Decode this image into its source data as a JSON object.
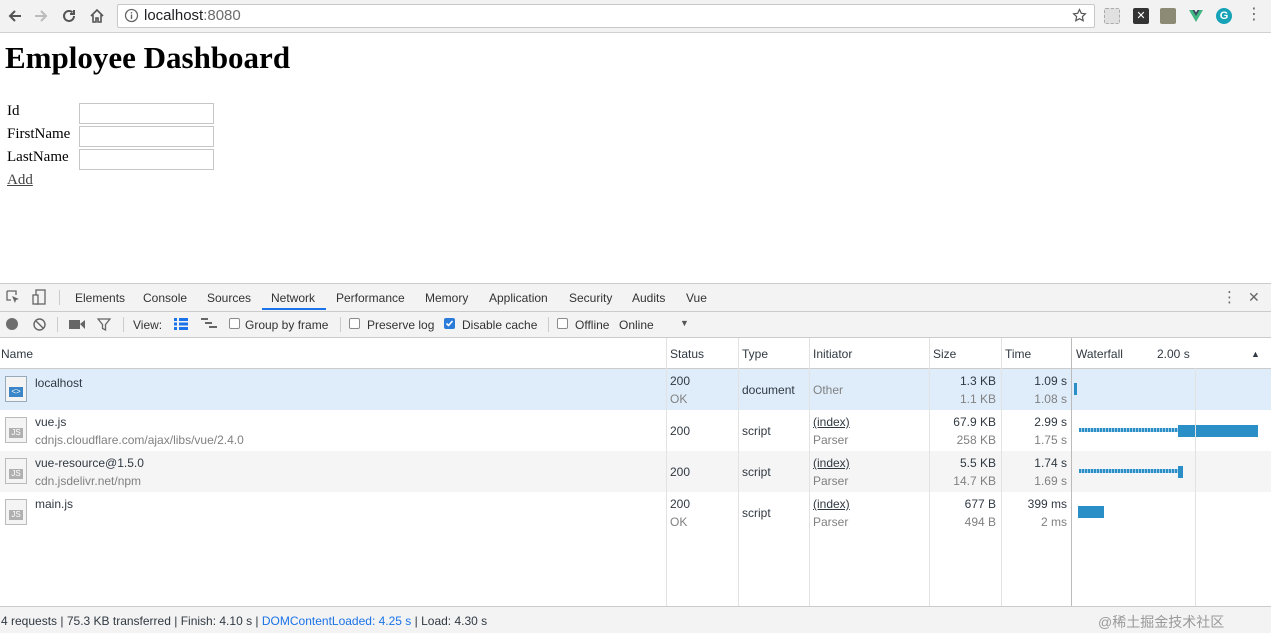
{
  "browser": {
    "url_host": "localhost",
    "url_port": ":8080"
  },
  "page": {
    "title": "Employee Dashboard",
    "fields": [
      {
        "label": "Id",
        "value": ""
      },
      {
        "label": "FirstName",
        "value": ""
      },
      {
        "label": "LastName",
        "value": ""
      }
    ],
    "add_link": "Add"
  },
  "devtools": {
    "tabs": [
      "Elements",
      "Console",
      "Sources",
      "Network",
      "Performance",
      "Memory",
      "Application",
      "Security",
      "Audits",
      "Vue"
    ],
    "active_tab": "Network",
    "toolbar": {
      "view_label": "View:",
      "group_by_frame": "Group by frame",
      "group_by_frame_checked": false,
      "preserve_log": "Preserve log",
      "preserve_log_checked": false,
      "disable_cache": "Disable cache",
      "disable_cache_checked": true,
      "offline": "Offline",
      "offline_checked": false,
      "throttle": "Online"
    },
    "columns": {
      "name": "Name",
      "status": "Status",
      "type": "Type",
      "initiator": "Initiator",
      "size": "Size",
      "time": "Time",
      "waterfall": "Waterfall",
      "waterfall_scale": "2.00 s"
    },
    "rows": [
      {
        "name": "localhost",
        "path": "",
        "status": "200",
        "status_text": "OK",
        "type": "document",
        "initiator": "Other",
        "initiator_sub": "",
        "size": "1.3 KB",
        "size_sub": "1.1 KB",
        "time": "1.09 s",
        "time_sub": "1.08 s",
        "icon": "html-document-icon"
      },
      {
        "name": "vue.js",
        "path": "cdnjs.cloudflare.com/ajax/libs/vue/2.4.0",
        "status": "200",
        "status_text": "",
        "type": "script",
        "initiator": "(index)",
        "initiator_sub": "Parser",
        "size": "67.9 KB",
        "size_sub": "258 KB",
        "time": "2.99 s",
        "time_sub": "1.75 s",
        "icon": "js-file-icon"
      },
      {
        "name": "vue-resource@1.5.0",
        "path": "cdn.jsdelivr.net/npm",
        "status": "200",
        "status_text": "",
        "type": "script",
        "initiator": "(index)",
        "initiator_sub": "Parser",
        "size": "5.5 KB",
        "size_sub": "14.7 KB",
        "time": "1.74 s",
        "time_sub": "1.69 s",
        "icon": "js-file-icon"
      },
      {
        "name": "main.js",
        "path": "",
        "status": "200",
        "status_text": "OK",
        "type": "script",
        "initiator": "(index)",
        "initiator_sub": "Parser",
        "size": "677 B",
        "size_sub": "494 B",
        "time": "399 ms",
        "time_sub": "2 ms",
        "icon": "js-file-icon"
      }
    ],
    "status_bar": {
      "requests": "4 requests",
      "transferred": "75.3 KB transferred",
      "finish": "Finish: 4.10 s",
      "dom_content_loaded": "DOMContentLoaded: 4.25 s",
      "load": "Load: 4.30 s"
    }
  },
  "watermark": "@稀土掘金技术社区",
  "colors": {
    "selected_row": "#dfedfb",
    "dom_content_loaded": "#1a73e8",
    "waterfall_bar": "#2a8fc6",
    "active_tab_underline": "#1a73e8"
  }
}
